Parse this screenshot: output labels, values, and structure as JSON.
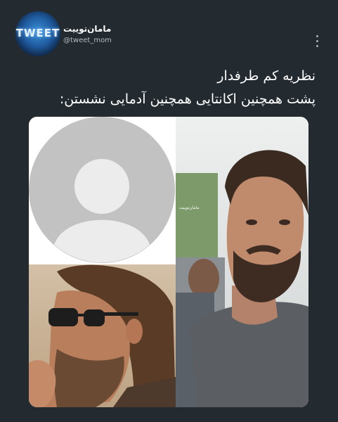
{
  "author": {
    "avatar_text": "TWEET",
    "display_name": "مامان‌توییت",
    "handle": "@tweet_mom"
  },
  "icons": {
    "more": "more-vertical-icon"
  },
  "tweet": {
    "lines": [
      "نظریه کم طرفدار",
      "پشت همچنین اکانتایی همچنین آدمایی نشستن:"
    ]
  },
  "media": {
    "watermark": "مامان‌توییت"
  },
  "colors": {
    "background": "#232b31",
    "placeholder_circle": "#c2c2c2",
    "placeholder_figure": "#ececec"
  }
}
